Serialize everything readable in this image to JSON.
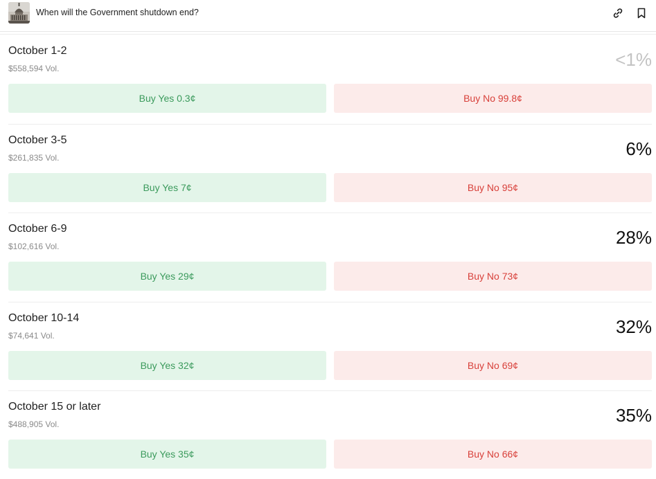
{
  "header": {
    "title": "When will the Government shutdown end?",
    "thumbnail_icon": "capitol-building-icon",
    "link_icon": "link-icon",
    "bookmark_icon": "bookmark-icon"
  },
  "colors": {
    "yes_bg": "#e3f5e9",
    "yes_text": "#3b9a5c",
    "no_bg": "#fcebea",
    "no_text": "#d8403a",
    "low_pct": "#c3c3c3"
  },
  "outcomes": [
    {
      "label": "October 1-2",
      "volume": "$558,594 Vol.",
      "probability": "<1%",
      "yes": "Buy Yes 0.3¢",
      "no": "Buy No 99.8¢"
    },
    {
      "label": "October 3-5",
      "volume": "$261,835 Vol.",
      "probability": "6%",
      "yes": "Buy Yes 7¢",
      "no": "Buy No 95¢"
    },
    {
      "label": "October 6-9",
      "volume": "$102,616 Vol.",
      "probability": "28%",
      "yes": "Buy Yes 29¢",
      "no": "Buy No 73¢"
    },
    {
      "label": "October 10-14",
      "volume": "$74,641 Vol.",
      "probability": "32%",
      "yes": "Buy Yes 32¢",
      "no": "Buy No 69¢"
    },
    {
      "label": "October 15 or later",
      "volume": "$488,905 Vol.",
      "probability": "35%",
      "yes": "Buy Yes 35¢",
      "no": "Buy No 66¢"
    }
  ]
}
